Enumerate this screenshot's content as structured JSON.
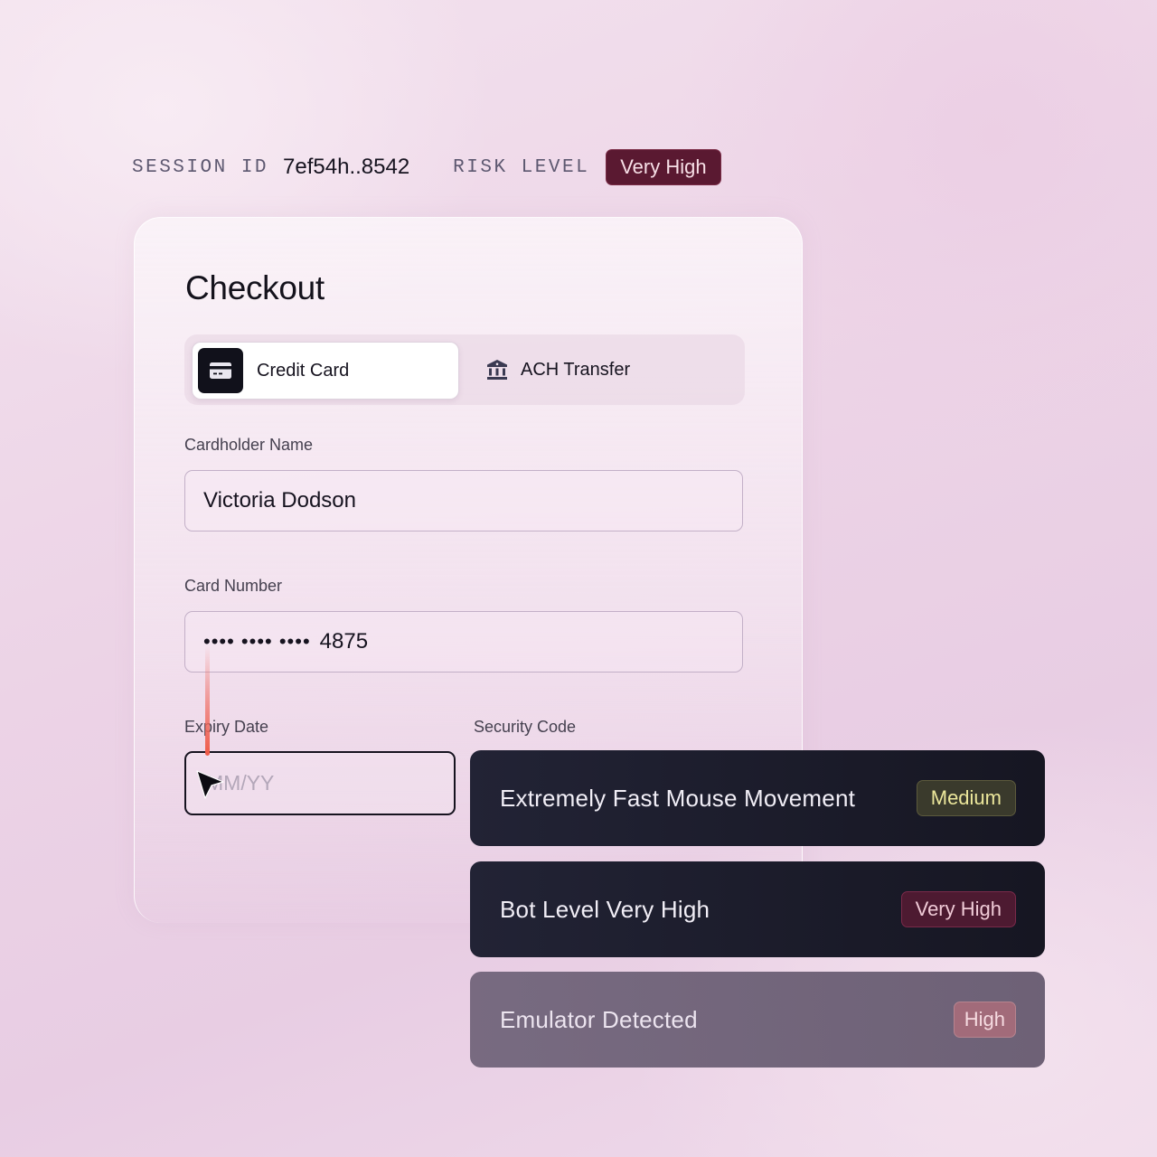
{
  "session": {
    "id_label": "SESSION ID",
    "id_value": "7ef54h..8542",
    "risk_label": "RISK LEVEL",
    "risk_value": "Very High",
    "risk_color": "#5a1931"
  },
  "checkout": {
    "title": "Checkout",
    "tabs": [
      {
        "label": "Credit Card",
        "icon": "credit-card-icon",
        "active": true
      },
      {
        "label": "ACH Transfer",
        "icon": "bank-icon",
        "active": false
      }
    ],
    "fields": {
      "cardholder_label": "Cardholder Name",
      "cardholder_value": "Victoria Dodson",
      "card_number_label": "Card Number",
      "card_number_mask": "•••• •••• ••••",
      "card_number_last4": "4875",
      "expiry_label": "Expiry Date",
      "expiry_placeholder": "MM/YY",
      "security_label": "Security Code"
    }
  },
  "alerts": [
    {
      "text": "Extremely Fast Mouse Movement",
      "severity": "Medium",
      "severity_color": "#ece79b"
    },
    {
      "text": "Bot Level Very High",
      "severity": "Very High",
      "severity_color": "#f0cbd7"
    },
    {
      "text": "Emulator Detected",
      "severity": "High",
      "severity_color": "#f6dbe1"
    }
  ],
  "cursor": {
    "icon": "mouse-pointer-icon"
  }
}
